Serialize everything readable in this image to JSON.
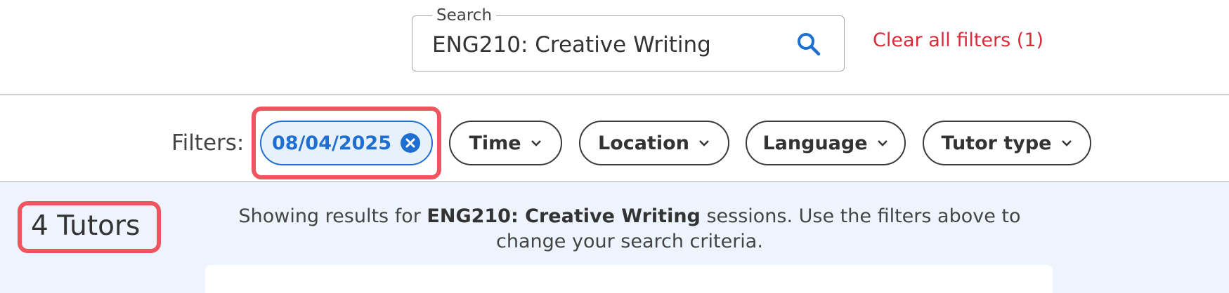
{
  "search": {
    "label": "Search",
    "value": "ENG210: Creative Writing",
    "icon": "search-icon",
    "clear_label": "Clear all filters (1)"
  },
  "filters": {
    "label": "Filters:",
    "active": {
      "label": "08/04/2025",
      "icon": "close-circle-icon"
    },
    "dropdowns": [
      {
        "label": "Time"
      },
      {
        "label": "Location"
      },
      {
        "label": "Language"
      },
      {
        "label": "Tutor type"
      }
    ]
  },
  "results": {
    "count_label": "4 Tutors",
    "summary_prefix": "Showing results for ",
    "summary_course": "ENG210: Creative Writing",
    "summary_suffix": " sessions. Use the filters above to change your search criteria."
  },
  "colors": {
    "accent": "#1f6fd1",
    "clear_link": "#d92b3a",
    "highlight": "#f0555f",
    "results_bg": "#edf4fd"
  }
}
